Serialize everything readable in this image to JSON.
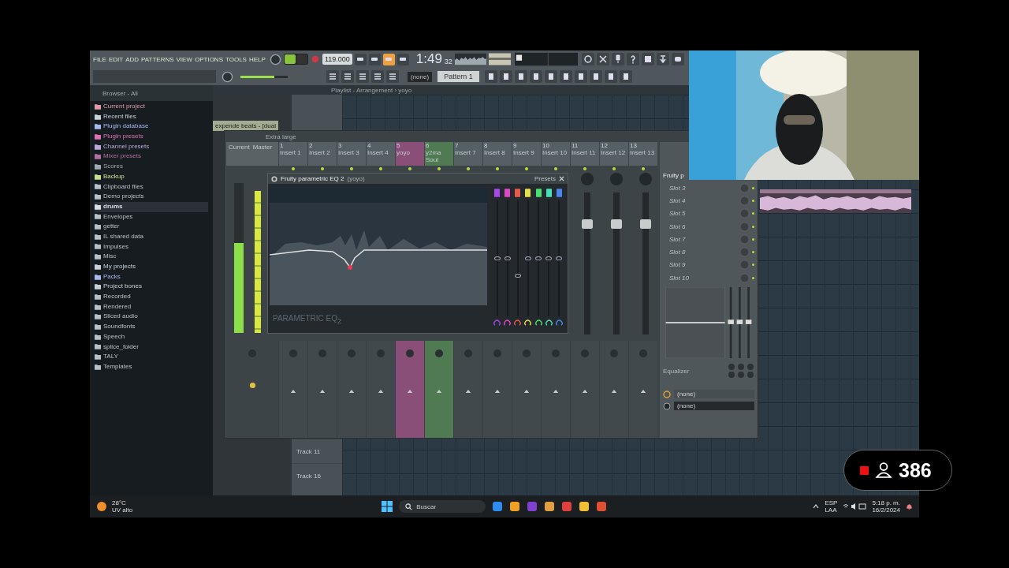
{
  "menu": [
    "FILE",
    "EDIT",
    "ADD",
    "PATTERNS",
    "VIEW",
    "OPTIONS",
    "TOOLS",
    "HELP"
  ],
  "transport": {
    "tempo": "119.000",
    "time": "1:49",
    "time_small": "32",
    "pattern": "Pattern 1",
    "pattern_none": "(none)",
    "master_volume": {
      "level": 0.72
    }
  },
  "browser": {
    "title": "Browser - All",
    "items": [
      {
        "label": "Current project",
        "color": "#e09aa8",
        "selected": false
      },
      {
        "label": "Recent files",
        "color": "#c8d0d8",
        "selected": false
      },
      {
        "label": "Plugin database",
        "color": "#a8b8f0",
        "selected": false
      },
      {
        "label": "Plugin presets",
        "color": "#e070b0",
        "selected": false
      },
      {
        "label": "Channel presets",
        "color": "#b8a8d8",
        "selected": false
      },
      {
        "label": "Mixer presets",
        "color": "#b070a0",
        "selected": false
      },
      {
        "label": "Scores",
        "color": "#a0a8b0",
        "selected": false
      },
      {
        "label": "Backup",
        "color": "#c8e090",
        "selected": false
      },
      {
        "label": "Clipboard files",
        "color": "#b8c0c8",
        "selected": false
      },
      {
        "label": "Demo projects",
        "color": "#b8c0c8",
        "selected": false
      },
      {
        "label": "drums",
        "color": "#d8dde2",
        "selected": true
      },
      {
        "label": "Envelopes",
        "color": "#b8c0c8",
        "selected": false
      },
      {
        "label": "getter",
        "color": "#b8c0c8",
        "selected": false
      },
      {
        "label": "IL shared data",
        "color": "#b8c0c8",
        "selected": false
      },
      {
        "label": "Impulses",
        "color": "#b8c0c8",
        "selected": false
      },
      {
        "label": "Misc",
        "color": "#b8c0c8",
        "selected": false
      },
      {
        "label": "My projects",
        "color": "#c8d0d8",
        "selected": false
      },
      {
        "label": "Packs",
        "color": "#a8b8f0",
        "selected": false
      },
      {
        "label": "Project bones",
        "color": "#c8d0d8",
        "selected": false
      },
      {
        "label": "Recorded",
        "color": "#b8c0c8",
        "selected": false
      },
      {
        "label": "Rendered",
        "color": "#b8c0c8",
        "selected": false
      },
      {
        "label": "Sliced audio",
        "color": "#b8c0c8",
        "selected": false
      },
      {
        "label": "Soundfonts",
        "color": "#b8c0c8",
        "selected": false
      },
      {
        "label": "Speech",
        "color": "#b8c0c8",
        "selected": false
      },
      {
        "label": "splice_folder",
        "color": "#b8c0c8",
        "selected": false
      },
      {
        "label": "TALY",
        "color": "#b8c0c8",
        "selected": false
      },
      {
        "label": "Templates",
        "color": "#b8c0c8",
        "selected": false
      }
    ]
  },
  "playlist": {
    "title": "Playlist - Arrangement › yoyo",
    "tab": "expende beats - [dual",
    "tracks": [
      "Track 11",
      "Track 16"
    ]
  },
  "mixer": {
    "size": "Extra large",
    "current": "Current",
    "master": "Master",
    "meter": {
      "level": 0.6
    },
    "strips": [
      {
        "number": "1",
        "name": "Insert 1"
      },
      {
        "number": "2",
        "name": "Insert 2"
      },
      {
        "number": "3",
        "name": "Insert 3"
      },
      {
        "number": "4",
        "name": "Insert 4"
      },
      {
        "number": "5",
        "name": "yoyo",
        "color": "#8a4f78"
      },
      {
        "number": "6",
        "name": "y2ma Soul",
        "color": "#4f7a52"
      },
      {
        "number": "7",
        "name": "Insert 7"
      },
      {
        "number": "8",
        "name": "Insert 8"
      },
      {
        "number": "9",
        "name": "Insert 9"
      },
      {
        "number": "10",
        "name": "Insert 10"
      },
      {
        "number": "11",
        "name": "Insert 11",
        "level": 0.78
      },
      {
        "number": "12",
        "name": "Insert 12",
        "level": 0.78
      },
      {
        "number": "13",
        "name": "Insert 13",
        "level": 0.78
      }
    ]
  },
  "eq": {
    "title": "Fruity parametric EQ 2",
    "target": "(yoyo)",
    "presets": "Presets",
    "logo": "PARAMETRIC EQ",
    "logo_sub": "2",
    "bands": [
      {
        "color": "#a948e8",
        "level": 0.5
      },
      {
        "color": "#e048c8",
        "level": 0.5
      },
      {
        "color": "#e85a4a",
        "level": 0.35
      },
      {
        "color": "#e4e04a",
        "level": 0.5
      },
      {
        "color": "#4ae070",
        "level": 0.5
      },
      {
        "color": "#48e0b8",
        "level": 0.5
      },
      {
        "color": "#4a88f0",
        "level": 0.5
      }
    ]
  },
  "slots": {
    "title": "Fruity p",
    "items": [
      "Slot 3",
      "Slot 4",
      "Slot 5",
      "Slot 6",
      "Slot 7",
      "Slot 8",
      "Slot 9",
      "Slot 10"
    ],
    "equalizer": "Equalizer",
    "route_1": "(none)",
    "route_2": "(none)"
  },
  "taskbar": {
    "temp": "28°C",
    "weather": "UV alto",
    "search": "Buscar",
    "lang": "ESP",
    "layout": "LAA",
    "time": "5:18 p. m.",
    "date": "16/2/2024"
  },
  "viewers": "386"
}
